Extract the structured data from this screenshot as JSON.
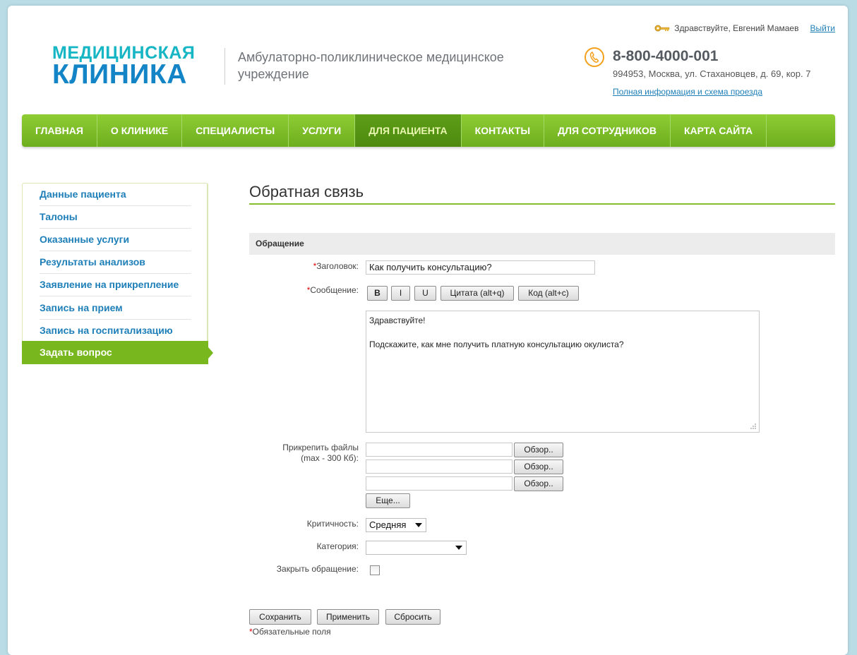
{
  "header": {
    "logo_line1": "МЕДИЦИНСКАЯ",
    "logo_line2": "КЛИНИКА",
    "tagline": "Амбулаторно-поликлиническое медицинское учреждение",
    "greeting": "Здравствуйте, Евгений Мамаев",
    "logout": "Выйти",
    "phone": "8-800-4000-001",
    "address": "994953, Москва, ул. Стахановцев, д. 69, кор. 7",
    "route_link": "Полная информация и схема проезда"
  },
  "nav": {
    "items": [
      "Главная",
      "О клинике",
      "Специалисты",
      "Услуги",
      "Для пациента",
      "Контакты",
      "Для сотрудников",
      "Карта сайта"
    ],
    "active": "Для пациента"
  },
  "sidebar": {
    "items": [
      "Данные пациента",
      "Талоны",
      "Оказанные услуги",
      "Результаты анализов",
      "Заявление на прикрепление",
      "Запись на прием",
      "Запись на госпитализацию",
      "Задать вопрос"
    ],
    "active": "Задать вопрос"
  },
  "main": {
    "title": "Обратная связь",
    "section": "Обращение",
    "form": {
      "subject_label": "Заголовок:",
      "subject_value": "Как получить консультацию?",
      "message_label": "Сообщение:",
      "toolbar": {
        "bold": "B",
        "italic": "I",
        "underline": "U",
        "quote": "Цитата (alt+q)",
        "code": "Код (alt+c)"
      },
      "message_line1": "Здравствуйте!",
      "message_line2": "Подскажите, как мне получить платную консультацию окулиста?",
      "attach_label_line1": "Прикрепить файлы",
      "attach_label_line2": "(max - 300 Кб):",
      "browse": "Обзор..",
      "more": "Еще...",
      "priority_label": "Критичность:",
      "priority_value": "Средняя",
      "category_label": "Категория:",
      "category_value": "",
      "close_label": "Закрыть обращение:",
      "close_checked": false
    },
    "buttons": {
      "save": "Сохранить",
      "apply": "Применить",
      "reset": "Сбросить"
    },
    "required_note": "Обязательные поля",
    "required_mark": "*"
  },
  "colors": {
    "nav_green": "#78b71e",
    "link_blue": "#1e7fb8",
    "logo_cyan": "#16b6c4",
    "logo_blue": "#1385c6",
    "accent_orange": "#f3a11c",
    "background": "#b9dce5"
  },
  "icons": {
    "user": "key-icon",
    "phone": "phone-icon",
    "resize": "resize-grip-icon",
    "dropdown": "chevron-down-icon"
  }
}
